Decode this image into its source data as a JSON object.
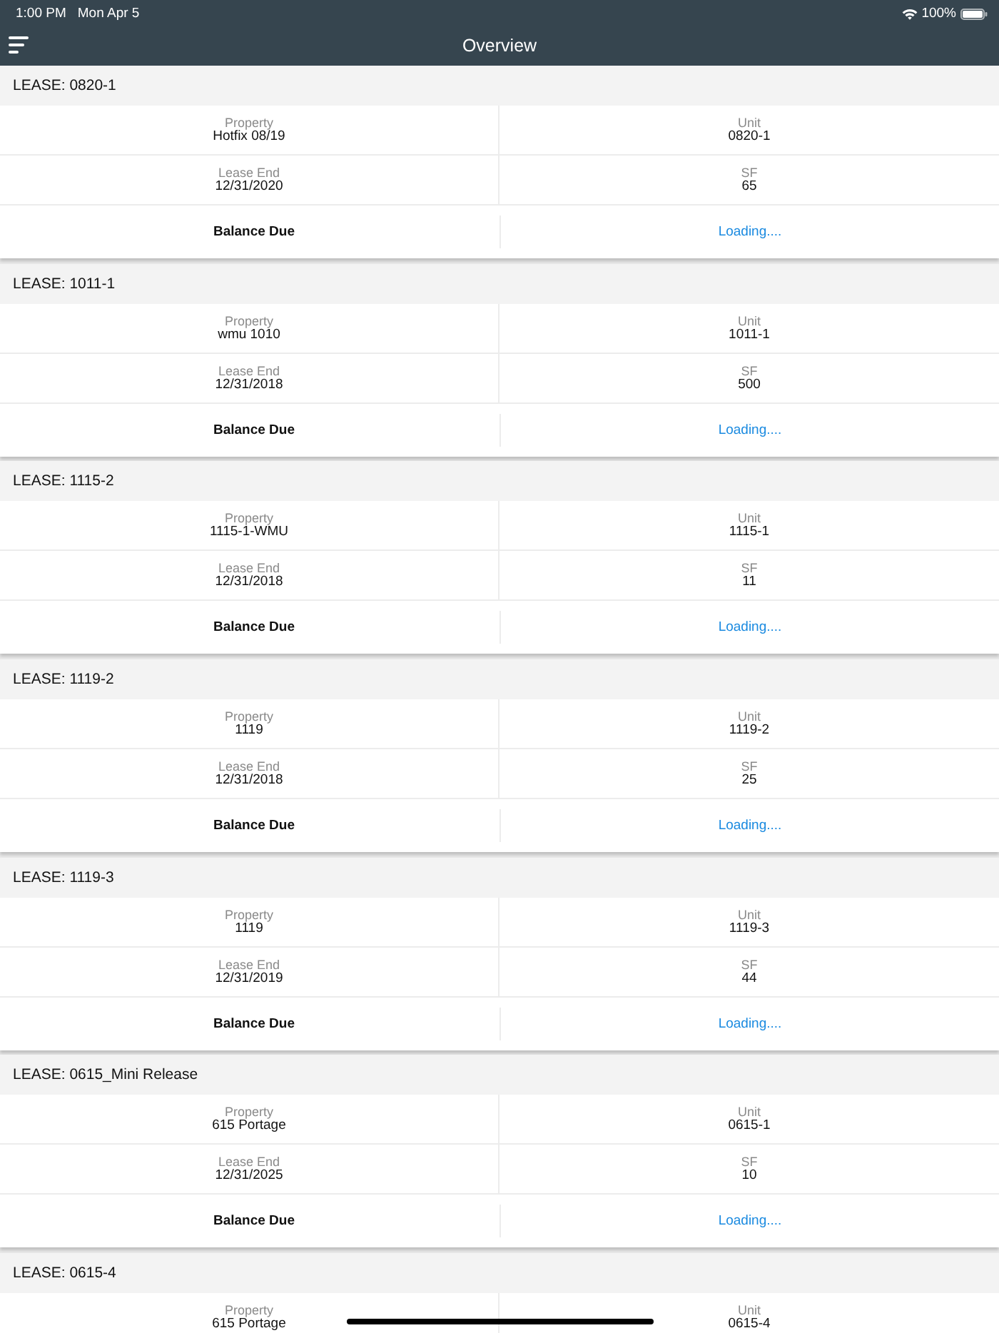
{
  "status_bar": {
    "time": "1:00 PM",
    "date": "Mon Apr 5",
    "battery": "100%"
  },
  "nav_bar": {
    "title": "Overview"
  },
  "leases": [
    {
      "title": "LEASE: 0820-1",
      "fields": [
        {
          "label": "Property",
          "value": "Hotfix 08/19"
        },
        {
          "label": "Unit",
          "value": "0820-1"
        },
        {
          "label": "Lease End",
          "value": "12/31/2020"
        },
        {
          "label": "SF",
          "value": "65"
        }
      ],
      "balance": {
        "label": "Balance Due",
        "value": "Loading...."
      }
    },
    {
      "title": "LEASE: 1011-1",
      "fields": [
        {
          "label": "Property",
          "value": "wmu 1010"
        },
        {
          "label": "Unit",
          "value": "1011-1"
        },
        {
          "label": "Lease End",
          "value": "12/31/2018"
        },
        {
          "label": "SF",
          "value": "500"
        }
      ],
      "balance": {
        "label": "Balance Due",
        "value": "Loading...."
      }
    },
    {
      "title": "LEASE: 1115-2",
      "fields": [
        {
          "label": "Property",
          "value": "1115-1-WMU"
        },
        {
          "label": "Unit",
          "value": "1115-1"
        },
        {
          "label": "Lease End",
          "value": "12/31/2018"
        },
        {
          "label": "SF",
          "value": "11"
        }
      ],
      "balance": {
        "label": "Balance Due",
        "value": "Loading...."
      }
    },
    {
      "title": "LEASE: 1119-2",
      "fields": [
        {
          "label": "Property",
          "value": "1119"
        },
        {
          "label": "Unit",
          "value": "1119-2"
        },
        {
          "label": "Lease End",
          "value": "12/31/2018"
        },
        {
          "label": "SF",
          "value": "25"
        }
      ],
      "balance": {
        "label": "Balance Due",
        "value": "Loading...."
      }
    },
    {
      "title": "LEASE: 1119-3",
      "fields": [
        {
          "label": "Property",
          "value": "1119"
        },
        {
          "label": "Unit",
          "value": "1119-3"
        },
        {
          "label": "Lease End",
          "value": "12/31/2019"
        },
        {
          "label": "SF",
          "value": "44"
        }
      ],
      "balance": {
        "label": "Balance Due",
        "value": "Loading...."
      }
    },
    {
      "title": "LEASE: 0615_Mini Release",
      "fields": [
        {
          "label": "Property",
          "value": "615 Portage"
        },
        {
          "label": "Unit",
          "value": "0615-1"
        },
        {
          "label": "Lease End",
          "value": "12/31/2025"
        },
        {
          "label": "SF",
          "value": "10"
        }
      ],
      "balance": {
        "label": "Balance Due",
        "value": "Loading...."
      }
    },
    {
      "title": "LEASE: 0615-4",
      "fields": [
        {
          "label": "Property",
          "value": "615 Portage"
        },
        {
          "label": "Unit",
          "value": "0615-4"
        }
      ]
    }
  ]
}
